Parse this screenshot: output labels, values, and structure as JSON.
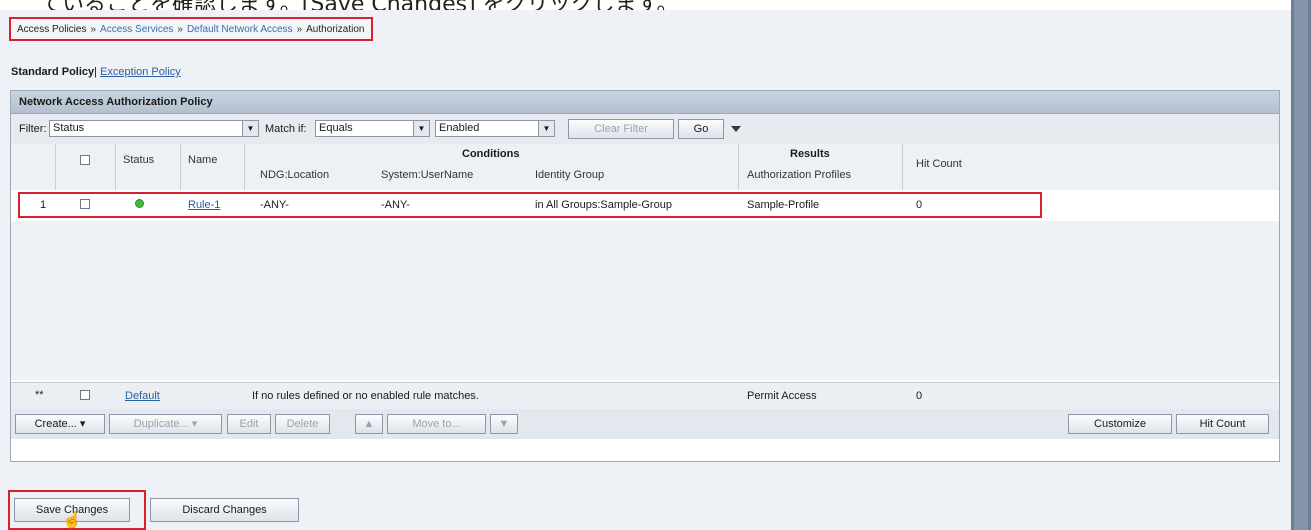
{
  "header_strip_text": "ていることを確認します。[Save Changes] をクリックします。",
  "breadcrumb": {
    "items": [
      "Access Policies",
      "Access Services",
      "Default Network Access"
    ],
    "current": "Authorization",
    "separator": "»"
  },
  "policy_tabs": {
    "active": "Standard Policy",
    "separator": "|",
    "other": "Exception Policy"
  },
  "panel": {
    "title": "Network Access Authorization Policy",
    "filter": {
      "filter_label": "Filter:",
      "filter_value": "Status",
      "match_label": "Match if:",
      "match_value": "Equals",
      "value": "Enabled",
      "clear_filter": "Clear Filter",
      "go": "Go"
    },
    "columns": {
      "status": "Status",
      "name": "Name",
      "conditions": "Conditions",
      "ndg_location": "NDG:Location",
      "system_username": "System:UserName",
      "identity_group": "Identity Group",
      "results": "Results",
      "authorization_profiles": "Authorization Profiles",
      "hit_count": "Hit Count"
    },
    "rules": [
      {
        "index": "1",
        "status": "enabled",
        "name": "Rule-1",
        "ndg_location": "-ANY-",
        "system_username": "-ANY-",
        "identity_group": "in All Groups:Sample-Group",
        "authorization_profile": "Sample-Profile",
        "hit_count": "0"
      }
    ],
    "default_rule": {
      "index": "**",
      "name": "Default",
      "description": "If no rules defined or no enabled rule matches.",
      "result": "Permit Access",
      "hit_count": "0"
    },
    "actions": {
      "create": "Create...",
      "duplicate": "Duplicate...",
      "edit": "Edit",
      "delete": "Delete",
      "move_to": "Move to...",
      "customize": "Customize",
      "hit_count": "Hit Count"
    }
  },
  "footer": {
    "save": "Save Changes",
    "discard": "Discard Changes"
  },
  "colors": {
    "highlight": "#d8212c",
    "link": "#2a5fa5",
    "enabled_status": "#3dbb3d"
  }
}
